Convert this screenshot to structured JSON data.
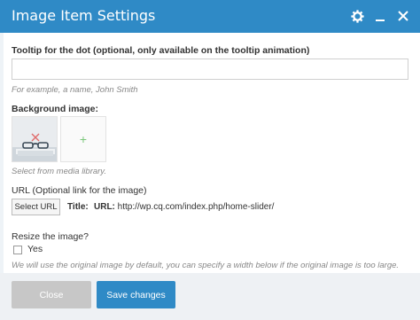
{
  "dialog": {
    "title": "Image Item Settings",
    "icons": [
      "gear-icon",
      "minimize-icon",
      "close-icon"
    ]
  },
  "tooltip": {
    "label": "Tooltip for the dot (optional, only available on the tooltip animation)",
    "value": "",
    "hint": "For example, a name, John Smith"
  },
  "background": {
    "label": "Background image:",
    "hint": "Select from media library.",
    "add_symbol": "+"
  },
  "url": {
    "label": "URL (Optional link for the image)",
    "select_button": "Select URL",
    "title_label": "Title:",
    "url_label": "URL:",
    "url_value": "http://wp.cq.com/index.php/home-slider/"
  },
  "resize": {
    "label": "Resize the image?",
    "checkbox_label": "Yes",
    "checked": false,
    "hint": "We will use the original image by default, you can specify a width below if the original image is too large."
  },
  "footer": {
    "close_label": "Close",
    "save_label": "Save changes"
  },
  "colors": {
    "accent": "#2f8ac6",
    "footer_bg": "#eef1f4",
    "close_bg": "#c7c7c7",
    "delete_x": "#e06b6b",
    "add_plus": "#7ac77a"
  }
}
